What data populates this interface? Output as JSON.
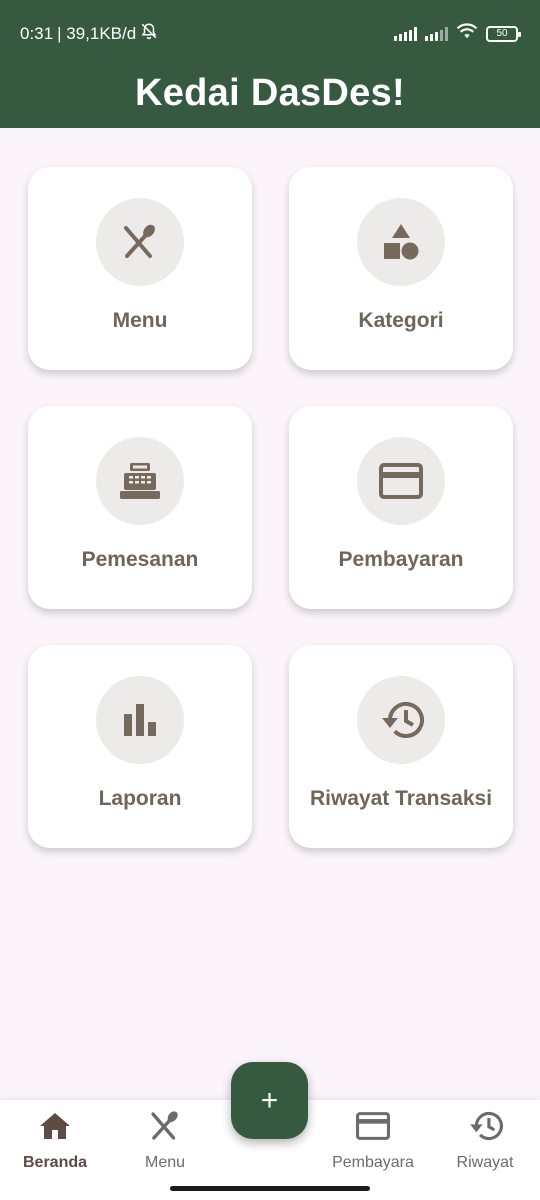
{
  "status_bar": {
    "time": "0:31",
    "network_speed": "| 39,1KB/d",
    "battery_level": "50",
    "icons": [
      "bell-off-icon",
      "signal-icon",
      "signal-icon",
      "wifi-icon",
      "battery-icon"
    ]
  },
  "app_bar": {
    "title": "Kedai DasDes!"
  },
  "menu_cards": [
    {
      "label": "Menu",
      "icon": "fork-spoon-icon"
    },
    {
      "label": "Kategori",
      "icon": "shapes-icon"
    },
    {
      "label": "Pemesanan",
      "icon": "cash-register-icon"
    },
    {
      "label": "Pembayaran",
      "icon": "credit-card-icon"
    },
    {
      "label": "Laporan",
      "icon": "bar-chart-icon"
    },
    {
      "label": "Riwayat Transaksi",
      "icon": "history-icon"
    }
  ],
  "bottom_nav": {
    "items": [
      {
        "label": "Beranda",
        "icon": "home-icon",
        "active": true
      },
      {
        "label": "Menu",
        "icon": "fork-spoon-icon",
        "active": false
      },
      {
        "label": "Pembayara",
        "icon": "credit-card-icon",
        "active": false
      },
      {
        "label": "Riwayat",
        "icon": "history-icon",
        "active": false
      }
    ]
  },
  "fab": {
    "label": "+"
  },
  "colors": {
    "primary": "#355a3f",
    "background": "#fcf4fb",
    "card_text": "#6f6558",
    "icon": "#756a5c",
    "icon_circle": "#ecebea"
  }
}
